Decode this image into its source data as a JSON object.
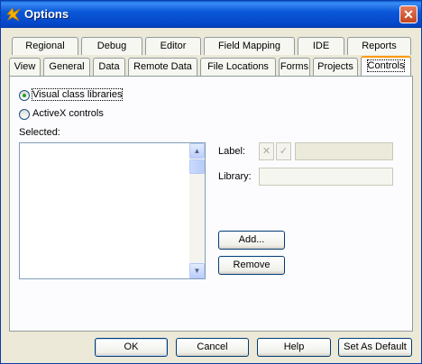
{
  "window": {
    "title": "Options",
    "close_glyph": "✕"
  },
  "tabs_row1": [
    "Regional",
    "Debug",
    "Editor",
    "Field Mapping",
    "IDE",
    "Reports"
  ],
  "tabs_row2": [
    "View",
    "General",
    "Data",
    "Remote Data",
    "File Locations",
    "Forms",
    "Projects",
    "Controls"
  ],
  "active_tab": "Controls",
  "options": {
    "visual_class_libraries": "Visual class libraries",
    "activex_controls": "ActiveX controls",
    "selected_option": "Visual class libraries"
  },
  "selected_label": "Selected:",
  "label_field": {
    "label": "Label:",
    "value": ""
  },
  "library_field": {
    "label": "Library:",
    "value": ""
  },
  "small_buttons": {
    "clear_glyph": "✕",
    "accept_glyph": "✓"
  },
  "buttons": {
    "add": "Add...",
    "remove": "Remove",
    "ok": "OK",
    "cancel": "Cancel",
    "help": "Help",
    "set_as_default": "Set As Default"
  },
  "colors": {
    "titlebar": "#0a58d8",
    "tab_active_accent": "#ff9900",
    "radio_dot": "#21a121"
  },
  "icons": {
    "title_icon": "foxpro-icon",
    "cursor": "hand-pointer-cursor"
  }
}
